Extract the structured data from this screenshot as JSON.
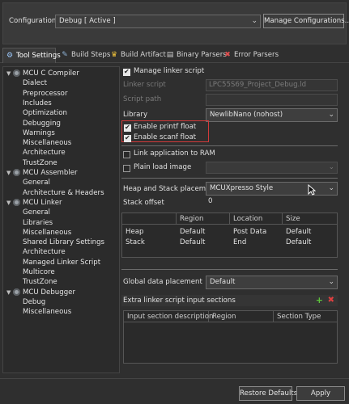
{
  "config": {
    "label": "Configuration:",
    "value": "Debug  [ Active ]",
    "manage_button": "Manage Configurations..."
  },
  "tabs": [
    {
      "label": "Tool Settings",
      "icon": "tool-settings-icon"
    },
    {
      "label": "Build Steps",
      "icon": "build-steps-icon"
    },
    {
      "label": "Build Artifact",
      "icon": "build-artifact-icon"
    },
    {
      "label": "Binary Parsers",
      "icon": "binary-parsers-icon"
    },
    {
      "label": "Error Parsers",
      "icon": "error-parsers-icon"
    }
  ],
  "tree": {
    "compiler": {
      "label": "MCU C Compiler",
      "children": [
        "Dialect",
        "Preprocessor",
        "Includes",
        "Optimization",
        "Debugging",
        "Warnings",
        "Miscellaneous",
        "Architecture",
        "TrustZone"
      ]
    },
    "assembler": {
      "label": "MCU Assembler",
      "children": [
        "General",
        "Architecture & Headers"
      ]
    },
    "linker": {
      "label": "MCU Linker",
      "children": [
        "General",
        "Libraries",
        "Miscellaneous",
        "Shared Library Settings",
        "Architecture",
        "Managed Linker Script",
        "Multicore",
        "TrustZone"
      ]
    },
    "debugger": {
      "label": "MCU Debugger",
      "children": [
        "Debug",
        "Miscellaneous"
      ]
    }
  },
  "settings": {
    "manage_linker_script": "Manage linker script",
    "linker_script_label": "Linker script",
    "linker_script_value": "LPC55S69_Project_Debug.ld",
    "script_path_label": "Script path",
    "library_label": "Library",
    "library_value": "NewlibNano (nohost)",
    "enable_printf": "Enable printf float",
    "enable_scanf": "Enable scanf float",
    "link_to_ram": "Link application to RAM",
    "plain_load_image": "Plain load image",
    "heap_stack_label": "Heap and Stack placement",
    "heap_stack_value": "MCUXpresso Style",
    "stack_offset_label": "Stack offset",
    "stack_offset_value": "0",
    "global_data_label": "Global data placement",
    "global_data_value": "Default",
    "extra_sections_label": "Extra linker script input sections"
  },
  "region_table": {
    "headers": [
      "",
      "Region",
      "Location",
      "Size"
    ],
    "rows": [
      [
        "Heap",
        "Default",
        "Post Data",
        "Default"
      ],
      [
        "Stack",
        "Default",
        "End",
        "Default"
      ]
    ]
  },
  "sections_table": {
    "headers": [
      "Input section description",
      "Region",
      "Section Type"
    ]
  },
  "footer": {
    "restore": "Restore Defaults",
    "apply": "Apply"
  }
}
